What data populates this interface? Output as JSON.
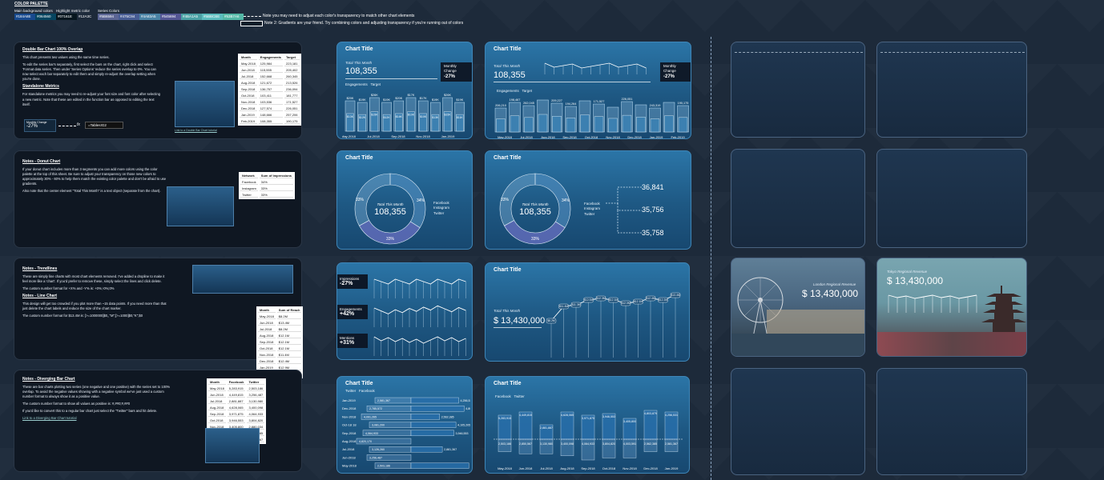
{
  "palette": {
    "title": "COLOR PALETTE",
    "main_bg_label": "Main background colors",
    "highlight_label": "Highlight metric color",
    "series_label": "Series Colors",
    "swatches": [
      {
        "hex": "#184A8E",
        "label": "#184A8E"
      },
      {
        "hex": "#064560",
        "label": "#064560"
      },
      {
        "hex": "#07161E",
        "label": "#07161E"
      },
      {
        "hex": "#12A3C",
        "label": "#12A3C"
      },
      {
        "hex": "#5B6594",
        "label": "#5B6594"
      },
      {
        "hex": "#475C94",
        "label": "#475C94"
      },
      {
        "hex": "#4A83A5",
        "label": "#4A83A5"
      },
      {
        "hex": "#545694",
        "label": "#545694"
      },
      {
        "hex": "#4BA1A5",
        "label": "#4BA1A5"
      },
      {
        "hex": "#5BBCBE",
        "label": "#5BBCBE"
      },
      {
        "hex": "#53B7A6",
        "label": "#53B7A6"
      }
    ],
    "note1": "Note you may need to adjust each color's transparency to match other chart elements",
    "note2": "Note 2: Gradients are your friend. Try combining colors and adjusting transparency if you're running out of colors"
  },
  "notes": {
    "n1": {
      "title": "Double Bar Chart 100% Overlap",
      "p1": "This chart presents two values using the same time series.",
      "p2": "To edit the series bar's separately, first select the bars on the chart, right click and select 'Format data series. Then under 'Series Options' reduce the series overlap to 0%. You can now select each bar separately to edit them and simply re-adjust the overlap setting when you're done.",
      "t2": "Standalone Metrics",
      "p3": "For standalone metrics you may need to re-adjust your font size and font color after selecting a new metric. Note that these are edited in the function bar as opposed to editing the text itself.",
      "mc_label": "Monthly Change",
      "mc_value": "-27%",
      "fx": "fx",
      "formula": "=Tables!G2",
      "link": "Link to a Double Bar Chart tutorial"
    },
    "n2": {
      "title": "Notes - Donut Chart",
      "p1": "If your donut chart includes more than 3 segments you can add more colors using the color palette at the top of this sheet. Be sure to adjust your transparency on those new colors to approximately 30% - 60% to help them match the existing color palette and don't be afraid to use gradients.",
      "p2": "Also note that the center element \"Total This Month\" is a text object (separate from the chart)."
    },
    "n3": {
      "title": "Notes - Trendlines",
      "p1": "These are simply line charts with most chart elements removed. I've added a dropline to make it feel more like a 'chart'. If you'd prefer to remove these, simply select the lines and click delete.",
      "p2": "The custom number format for +X% and -Y% is: +0%;-0%;0%",
      "t2": "Notes - Line Chart",
      "p3": "This design will get too crowded if you plot more than ~15 data points. If you need more than that just delete the chart labels and reduce the size of the chart marker.",
      "p4": "The custom number format for $13.4M is: [>=1000000]$0,,\"M\";[>=1000]$0,\"K\";$0"
    },
    "n4": {
      "title": "Notes - Diverging Bar Chart",
      "p1": "These are bar charts plotting two series (one negative and one positive) with the series set to 100% overlap. To avoid the negative values showing with a negative symbol we've just used a custom number format to always show it as a positive value.",
      "p2": "The custom number format to show all values as positive is: #,##0;#,##0",
      "p3": "If you'd like to convert this to a regular bar chart just select the \"Twitter\" bars and hit delete.",
      "link": "Link to a Diverging Bar Chart tutorial"
    }
  },
  "tables": {
    "t1": {
      "headers": [
        "Month",
        "Engagements",
        "Target"
      ],
      "rows": [
        [
          "May-2018",
          "125,984",
          "223,181"
        ],
        [
          "Jun-2018",
          "115,555",
          "205,402"
        ],
        [
          "Jul-2018",
          "152,668",
          "260,345"
        ],
        [
          "Aug-2018",
          "121,672",
          "213,526"
        ],
        [
          "Sep-2018",
          "136,757",
          "236,094"
        ],
        [
          "Oct-2018",
          "103,411",
          "181,777"
        ],
        [
          "Nov-2018",
          "103,536",
          "171,527"
        ],
        [
          "Dec-2018",
          "127,574",
          "226,051"
        ],
        [
          "Jan-2019",
          "148,666",
          "257,206"
        ],
        [
          "Feb-2019",
          "108,355",
          "190,175"
        ]
      ]
    },
    "t2": {
      "headers": [
        "Network",
        "Sum of Impressions"
      ],
      "rows": [
        [
          "Facebook",
          "34%"
        ],
        [
          "Instagram",
          "33%"
        ],
        [
          "Twitter",
          "33%"
        ]
      ]
    },
    "t3": {
      "headers": [
        "Month",
        "Sum of Reach"
      ],
      "rows": [
        [
          "May-2018",
          "$8.2M"
        ],
        [
          "Jun-2018",
          "$13.4M"
        ],
        [
          "Jul-2018",
          "$8.2M"
        ],
        [
          "Aug-2018",
          "$12.1M"
        ],
        [
          "Sep-2018",
          "$12.1M"
        ],
        [
          "Oct-2018",
          "$12.1M"
        ],
        [
          "Nov-2018",
          "$11.4M"
        ],
        [
          "Dec-2018",
          "$12.4M"
        ],
        [
          "Jan-2019",
          "$12.9M"
        ],
        [
          "Feb-2019",
          "$13.4M"
        ]
      ]
    },
    "t4": {
      "headers": [
        "Month",
        "Facebook",
        "Twitter"
      ],
      "rows": [
        [
          "May-2018",
          "5,283,915",
          "2,503,186"
        ],
        [
          "Jun-2018",
          "4,449,815",
          "3,256,487"
        ],
        [
          "Jul-2018",
          "2,881,887",
          "3,130,980"
        ],
        [
          "Aug-2018",
          "4,628,065",
          "3,400,098"
        ],
        [
          "Sep-2018",
          "3,971,875",
          "4,064,933"
        ],
        [
          "Oct-2018",
          "3,946,553",
          "3,804,820"
        ],
        [
          "Nov-2018",
          "3,405,800",
          "2,880,034"
        ],
        [
          "Dec-2018",
          "4,803,879",
          "2,562,385"
        ],
        [
          "Jan-2019",
          "4,256,531",
          "2,881,367"
        ]
      ]
    }
  },
  "cards": {
    "c1": {
      "title": "Chart Title",
      "sub": "Total This Month",
      "value": "108,355",
      "mc_label": "Monthly Change",
      "mc_value": "-27%",
      "legend": [
        "Engagements",
        "Target"
      ],
      "targets": [
        "$20K",
        "$19K",
        "$26K",
        "$19K",
        "$20K",
        "$17K",
        "$17K",
        "$19K",
        "$26K",
        "$19K"
      ],
      "engs": [
        "$13K",
        "$12K",
        "$15K",
        "$12K",
        "$14K",
        "$10K",
        "$10K",
        "$13K",
        "$15K",
        "$11K"
      ],
      "xlabels": [
        "May-2018",
        "Jul-2018",
        "Sep-2018",
        "Nov-2018",
        "Jan-2019"
      ]
    },
    "c2": {
      "title": "Chart Title",
      "sub": "Total This Month",
      "value": "108,355",
      "mc_label": "Monthly Change",
      "mc_value": "-27%",
      "legend": [
        "Engagements",
        "Target"
      ],
      "targets": [
        "206,210",
        "198,467",
        "262,045",
        "",
        "209,227",
        "194,264",
        "",
        "171,527",
        "",
        "226,051",
        "",
        "243,319",
        "",
        "190,175"
      ],
      "xlabels": [
        "May-2018",
        "Jul-2018",
        "Aug-2018",
        "Sep-2018",
        "Oct-2018",
        "Nov-2018",
        "Dec-2018",
        "Jan-2019",
        "Feb-2019"
      ]
    },
    "c3": {
      "title": "Chart Title",
      "sub": "Total This Month",
      "value": "108,355",
      "pcts": [
        "33%",
        "34%",
        "33%"
      ],
      "legend": [
        "Facebook",
        "Instagram",
        "Twitter"
      ]
    },
    "c4": {
      "title": "Chart Title",
      "sub": "Total This Month",
      "value": "108,355",
      "pcts": [
        "33%",
        "34%",
        "33%"
      ],
      "legend": [
        "Facebook",
        "Instagram",
        "Twitter"
      ],
      "callouts": [
        "36,841",
        "35,756",
        "35,758"
      ]
    },
    "c5": {
      "rows": [
        {
          "label": "Impressions",
          "value": "-27%"
        },
        {
          "label": "Engagements",
          "value": "+42%"
        },
        {
          "label": "Mentions",
          "value": "+31%"
        }
      ]
    },
    "c6": {
      "title": "Chart Title",
      "sub": "Total This Month",
      "value": "$ 13,430,000",
      "points": [
        "$8.2M",
        "$11.4M",
        "$11.3M",
        "$12.0M",
        "$12.3M",
        "$12.1M",
        "$12.0M",
        "$12.1M",
        "$12.4M",
        "$12.2M",
        "$13.4M"
      ]
    },
    "c7": {
      "title": "Chart Title",
      "legend": [
        "Twitter",
        "Facebook"
      ],
      "months": [
        "Jan-2019",
        "Dec-2018",
        "Nov-2018",
        "Oct-18 18",
        "Sep-2018",
        "Aug-2018",
        "Jul-2018",
        "Jun-2018",
        "May-2018"
      ],
      "left": [
        "2,581,367",
        "2,785,572",
        "4,091,265",
        "3,081,200",
        "4,064,933",
        "4,820,170",
        "3,126,260",
        "3,256,487",
        "2,503,186"
      ],
      "right": [
        "4,256,531",
        "4,803,879",
        "2,562,385",
        "4,105,205",
        "3,946,553",
        "",
        "2,881,367",
        "",
        "5,283,915"
      ]
    },
    "c8": {
      "title": "Chart Title",
      "legend": [
        "Facebook",
        "Twitter"
      ],
      "top": [
        "5,283,915",
        "4,449,815",
        "2,881,887",
        "4,628,065",
        "3,971,875",
        "3,946,553",
        "3,405,800",
        "4,803,879",
        "4,256,531"
      ],
      "bottom": [
        "2,503,186",
        "2,850,567",
        "3,130,980",
        "3,400,098",
        "4,064,933",
        "3,804,820",
        "4,003,591",
        "2,562,385",
        "2,581,367"
      ],
      "xlabels": [
        "May-2018",
        "Jun-2018",
        "Jul-2018",
        "Aug-2018",
        "Sep-2018",
        "Oct-2018",
        "Nov-2018",
        "Dec-2018",
        "Jan-2019"
      ]
    },
    "london": {
      "caption": "London Regional Revenue",
      "value": "$ 13,430,000"
    },
    "tokyo": {
      "caption": "Tokyo Regional Revenue",
      "value": "$ 13,430,000"
    }
  }
}
